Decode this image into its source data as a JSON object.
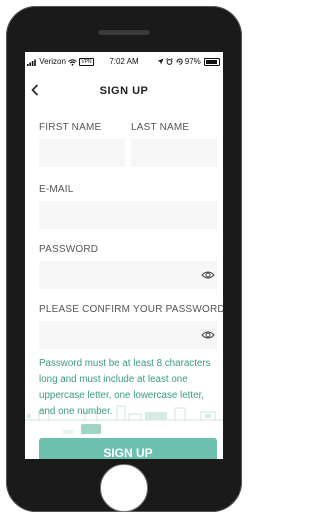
{
  "status_bar": {
    "carrier": "Verizon",
    "carrier_tag": "VPN",
    "time": "7:02 AM",
    "battery": "97%"
  },
  "header": {
    "back_icon": "chevron-left-icon",
    "title": "SIGN UP"
  },
  "form": {
    "first_name_label": "FIRST NAME",
    "last_name_label": "LAST NAME",
    "email_label": "E-MAIL",
    "password_label": "PASSWORD",
    "confirm_password_label": "PLEASE CONFIRM YOUR PASSWORD",
    "password_note": "Password must be at least 8 characters long and must include at least one uppercase letter, one lowercase letter, and one number.",
    "eye_icon": "eye-icon"
  },
  "actions": {
    "signup_label": "SIGN UP"
  },
  "colors": {
    "accent": "#3b9a85",
    "button": "#6dbfae",
    "field_bg": "#f7f7f7"
  }
}
